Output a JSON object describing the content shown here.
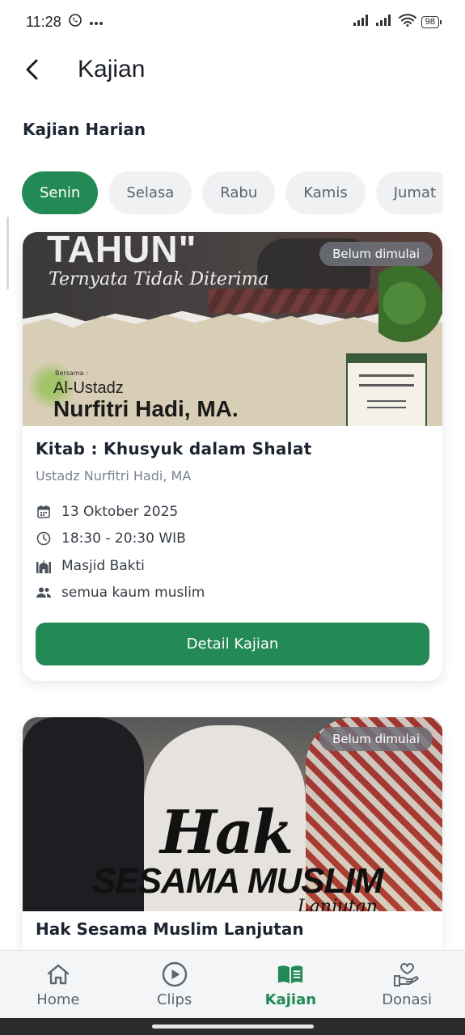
{
  "status_bar": {
    "time": "11:28",
    "battery": "98",
    "icons": [
      "whatsapp-icon",
      "more-icon",
      "signal-icon",
      "signal-icon",
      "wifi-icon",
      "battery-icon"
    ]
  },
  "app_bar": {
    "title": "Kajian",
    "back_icon": "chevron-left-icon"
  },
  "section_title": "Kajian Harian",
  "days": [
    {
      "label": "Senin",
      "active": true
    },
    {
      "label": "Selasa",
      "active": false
    },
    {
      "label": "Rabu",
      "active": false
    },
    {
      "label": "Kamis",
      "active": false
    },
    {
      "label": "Jumat",
      "active": false
    }
  ],
  "cards": [
    {
      "badge": "Belum dimulai",
      "banner": {
        "line1": "TAHUN\"",
        "line2": "Ternyata Tidak Diterima",
        "bersama": "Bersama :",
        "al_ustadz": "Al-Ustadz",
        "name": "Nurfitri Hadi, MA."
      },
      "title": "Kitab : Khusyuk dalam Shalat",
      "speaker": "Ustadz Nurfitri Hadi, MA",
      "date": "13 Oktober 2025",
      "time": "18:30 - 20:30 WIB",
      "location": "Masjid Bakti",
      "audience": "semua kaum muslim",
      "button_label": "Detail Kajian"
    },
    {
      "badge": "Belum dimulai",
      "banner": {
        "line1": "Hak",
        "line2": "SESAMA MUSLIM",
        "line3": "Lanjutan"
      },
      "title": "Hak Sesama Muslim Lanjutan"
    }
  ],
  "bottom_nav": [
    {
      "label": "Home",
      "icon": "home-icon",
      "active": false
    },
    {
      "label": "Clips",
      "icon": "play-circle-icon",
      "active": false
    },
    {
      "label": "Kajian",
      "icon": "book-icon",
      "active": true
    },
    {
      "label": "Donasi",
      "icon": "donate-hand-icon",
      "active": false
    }
  ],
  "colors": {
    "primary": "#238a55",
    "badge_bg": "#6e727a",
    "chip_bg": "#f0f1f3"
  }
}
